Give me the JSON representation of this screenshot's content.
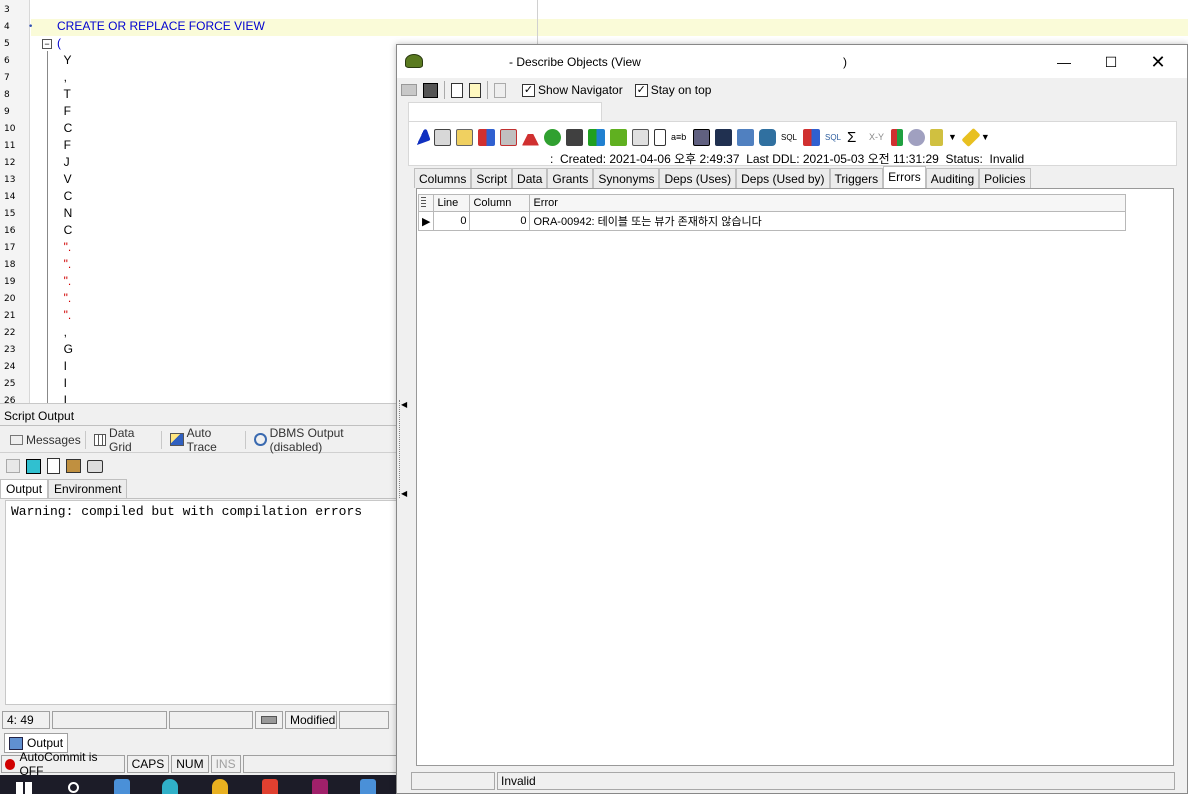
{
  "editor": {
    "lines": [
      {
        "n": "3",
        "text": ""
      },
      {
        "n": "4",
        "text": "CREATE OR REPLACE FORCE VIEW",
        "cls": "kw",
        "marker": "•"
      },
      {
        "n": "5",
        "text": "(",
        "cls": "kw"
      },
      {
        "n": "6",
        "text": "  Y"
      },
      {
        "n": "7",
        "text": "  ,"
      },
      {
        "n": "8",
        "text": "  T"
      },
      {
        "n": "9",
        "text": "  F"
      },
      {
        "n": "10",
        "text": "  C"
      },
      {
        "n": "11",
        "text": "  F"
      },
      {
        "n": "12",
        "text": "  J"
      },
      {
        "n": "13",
        "text": "  V"
      },
      {
        "n": "14",
        "text": "  C"
      },
      {
        "n": "15",
        "text": "  N"
      },
      {
        "n": "16",
        "text": "  C"
      },
      {
        "n": "17",
        "text": "  \".",
        "cls": "str"
      },
      {
        "n": "18",
        "text": "  \".",
        "cls": "str"
      },
      {
        "n": "19",
        "text": "  \".",
        "cls": "str"
      },
      {
        "n": "20",
        "text": "  \".",
        "cls": "str"
      },
      {
        "n": "21",
        "text": "  \".",
        "cls": "str"
      },
      {
        "n": "22",
        "text": "  ,"
      },
      {
        "n": "23",
        "text": "  G"
      },
      {
        "n": "24",
        "text": "  I"
      },
      {
        "n": "25",
        "text": "  I"
      },
      {
        "n": "26",
        "text": "  I"
      }
    ]
  },
  "script_output": {
    "header": "Script Output",
    "tabs": [
      "Messages",
      "Data Grid",
      "Auto Trace",
      "DBMS Output (disabled)"
    ],
    "subtabs": [
      "Output",
      "Environment"
    ],
    "text": "Warning: compiled but with compilation errors"
  },
  "status1": {
    "position": "4: 49",
    "modified": "Modified"
  },
  "output_tab": "Output",
  "status2": {
    "autocommit": "AutoCommit is OFF",
    "caps": "CAPS",
    "num": "NUM",
    "ins": "INS"
  },
  "describe": {
    "title": "- Describe Objects (View",
    "title_suffix": ")",
    "show_navigator": "Show Navigator",
    "stay_on_top": "Stay on top",
    "info": ":  Created: 2021-04-06 오후 2:49:37  Last DDL: 2021-05-03 오전 11:31:29  Status:  Invalid",
    "tabs": [
      "Columns",
      "Script",
      "Data",
      "Grants",
      "Synonyms",
      "Deps (Uses)",
      "Deps (Used by)",
      "Triggers",
      "Errors",
      "Auditing",
      "Policies"
    ],
    "active_tab": "Errors",
    "grid": {
      "headers": [
        "Line",
        "Column",
        "Error"
      ],
      "rows": [
        {
          "line": "0",
          "column": "0",
          "error": "ORA-00942: 테이블 또는 뷰가 존재하지 않습니다"
        }
      ]
    },
    "status": "Invalid"
  }
}
